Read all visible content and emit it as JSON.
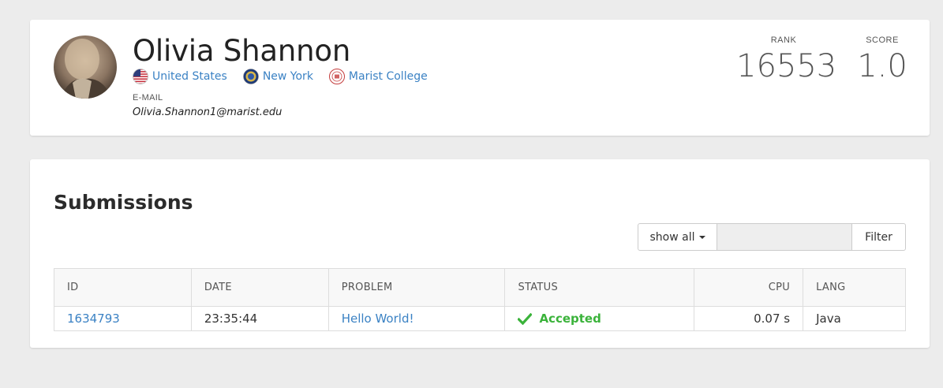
{
  "profile": {
    "name": "Olivia Shannon",
    "country": "United States",
    "state": "New York",
    "school": "Marist College",
    "email_label": "E-MAIL",
    "email": "Olivia.Shannon1@marist.edu",
    "rank_label": "RANK",
    "rank": "16553",
    "score_label": "SCORE",
    "score": "1.0"
  },
  "submissions": {
    "title": "Submissions",
    "filter": {
      "dropdown_label": "show all",
      "input_value": "",
      "button_label": "Filter"
    },
    "columns": [
      "ID",
      "DATE",
      "PROBLEM",
      "STATUS",
      "CPU",
      "LANG"
    ],
    "rows": [
      {
        "id": "1634793",
        "date": "23:35:44",
        "problem": "Hello World!",
        "status": "Accepted",
        "cpu": "0.07 s",
        "lang": "Java"
      }
    ]
  },
  "colors": {
    "link": "#3b82c4",
    "accepted": "#3bb33b",
    "background": "#ececec"
  },
  "icons": [
    "us-flag-icon",
    "new-york-seal-icon",
    "marist-college-seal-icon",
    "checkmark-icon",
    "caret-down-icon"
  ]
}
